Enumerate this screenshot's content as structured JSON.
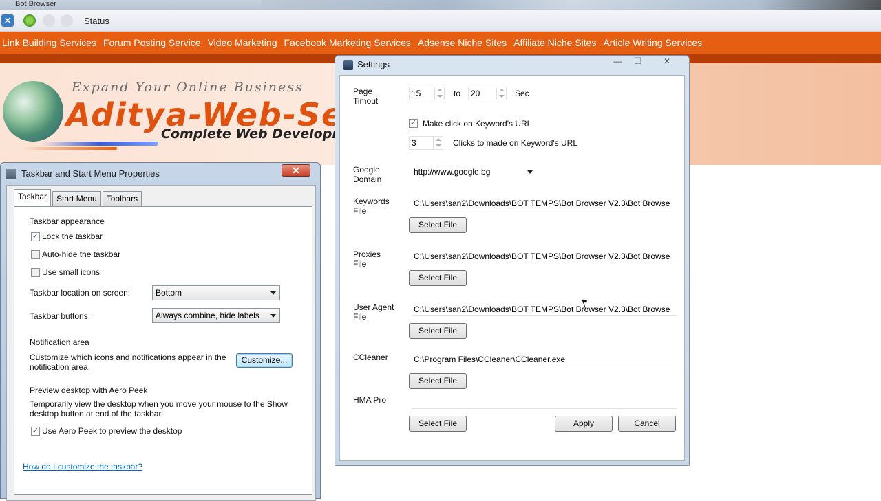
{
  "app": {
    "title": "Bot Browser",
    "status_label": "Status"
  },
  "site": {
    "nav": [
      "Link Building Services",
      "Forum Posting Service",
      "Video Marketing",
      "Facebook Marketing Services",
      "Adsense Niche Sites",
      "Affiliate Niche Sites",
      "Article Writing Services"
    ],
    "tagline": "Expand Your Online Business",
    "brand": "Aditya-Web-Ser",
    "brand_sub": "Complete Web Developm",
    "colors": {
      "nav_bg": "#e55e12",
      "brand": "#e05210"
    }
  },
  "taskbar_dialog": {
    "title": "Taskbar and Start Menu Properties",
    "close": "✕",
    "tabs": [
      "Taskbar",
      "Start Menu",
      "Toolbars"
    ],
    "appearance_heading": "Taskbar appearance",
    "lock": {
      "label": "Lock the taskbar",
      "checked": "✓"
    },
    "autohide": {
      "label": "Auto-hide the taskbar"
    },
    "small_icons": {
      "label": "Use small icons"
    },
    "location_label": "Taskbar location on screen:",
    "location_value": "Bottom",
    "buttons_label": "Taskbar buttons:",
    "buttons_value": "Always combine, hide labels",
    "notif_heading": "Notification area",
    "notif_text": "Customize which icons and notifications appear in the notification area.",
    "customize_button": "Customize...",
    "peek_heading": "Preview desktop with Aero Peek",
    "peek_text": "Temporarily view the desktop when you move your mouse to the Show desktop button at end of the taskbar.",
    "peek_check": {
      "label": "Use Aero Peek to preview the desktop",
      "checked": "✓"
    },
    "help_link": "How do I customize the taskbar?"
  },
  "settings": {
    "title": "Settings",
    "window_controls": [
      "—",
      "❐",
      "✕"
    ],
    "page_timeout": {
      "label": "Page Timout",
      "from": "15",
      "to_label": "to",
      "to": "20",
      "unit": "Sec"
    },
    "keyword_click": {
      "label": "Make click on Keyword's URL",
      "checked": "✓"
    },
    "clicks": {
      "value": "3",
      "label": "Clicks to made on Keyword's URL"
    },
    "google_domain": {
      "label": "Google Domain",
      "value": "http://www.google.bg"
    },
    "keywords_file": {
      "label": "Keywords File",
      "path": "C:\\Users\\san2\\Downloads\\BOT TEMPS\\Bot Browser V2.3\\Bot Browse"
    },
    "proxies_file": {
      "label": "Proxies File",
      "path": "C:\\Users\\san2\\Downloads\\BOT TEMPS\\Bot Browser V2.3\\Bot Browse"
    },
    "user_agent_file": {
      "label": "User Agent File",
      "path": "C:\\Users\\san2\\Downloads\\BOT TEMPS\\Bot Browser V2.3\\Bot Browse"
    },
    "ccleaner": {
      "label": "CCleaner",
      "path": "C:\\Program Files\\CCleaner\\CCleaner.exe"
    },
    "hma_pro": {
      "label": "HMA Pro",
      "path": ""
    },
    "select_file_label": "Select File",
    "apply": "Apply",
    "cancel": "Cancel"
  }
}
